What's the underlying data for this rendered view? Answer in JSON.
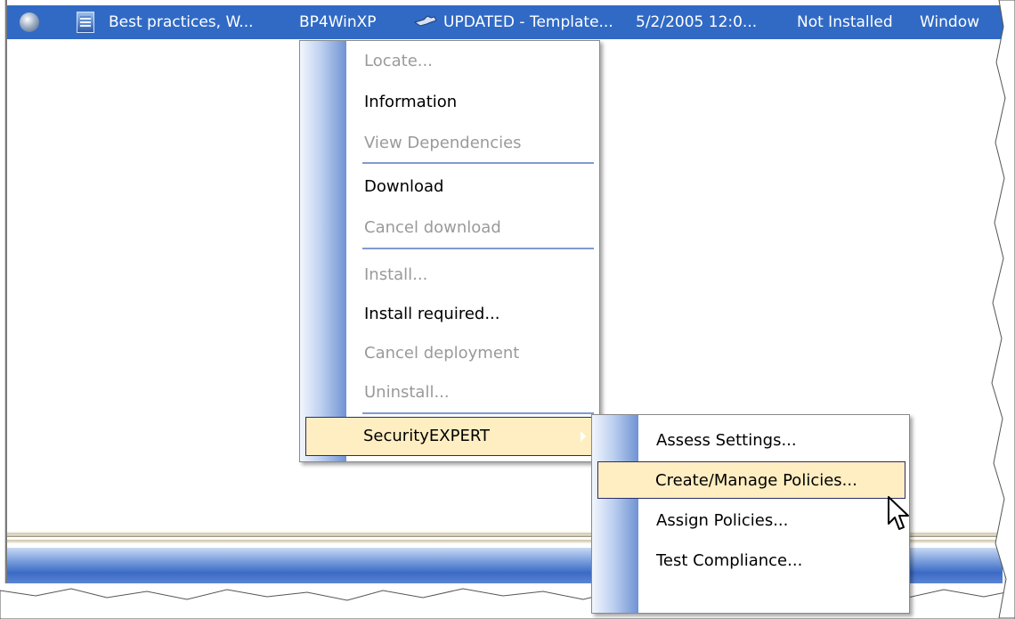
{
  "row": {
    "name": "Best practices, W...",
    "id": "BP4WinXP",
    "status": "UPDATED - Template...",
    "date": "5/2/2005 12:0...",
    "installed": "Not Installed",
    "platform": "Window"
  },
  "context_menu": {
    "items": [
      {
        "label": "Locate...",
        "enabled": false
      },
      {
        "label": "Information",
        "enabled": true
      },
      {
        "label": "View Dependencies",
        "enabled": false
      },
      {
        "label": "Download",
        "enabled": true
      },
      {
        "label": "Cancel download",
        "enabled": false
      },
      {
        "label": "Install...",
        "enabled": false
      },
      {
        "label": "Install required...",
        "enabled": true
      },
      {
        "label": "Cancel deployment",
        "enabled": false
      },
      {
        "label": "Uninstall...",
        "enabled": false
      },
      {
        "label": "SecurityEXPERT",
        "enabled": true,
        "highlighted": true,
        "has_submenu": true
      }
    ]
  },
  "submenu": {
    "items": [
      {
        "label": "Assess Settings..."
      },
      {
        "label": "Create/Manage Policies...",
        "highlighted": true
      },
      {
        "label": "Assign Policies..."
      },
      {
        "label": "Test Compliance..."
      }
    ]
  },
  "colors": {
    "selection": "#316ac5",
    "menu_highlight": "#ffeec2",
    "disabled_text": "#9a9a9a"
  }
}
